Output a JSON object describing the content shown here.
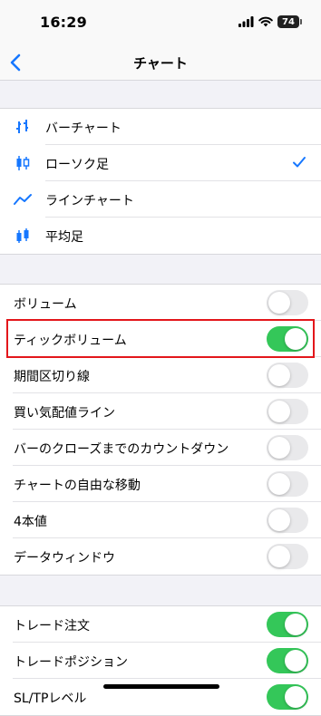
{
  "status_bar": {
    "time": "16:29",
    "battery": "74"
  },
  "nav": {
    "title": "チャート",
    "back_icon": "chevron-left-icon"
  },
  "chart_types": [
    {
      "label": "バーチャート",
      "icon": "bar-chart-icon",
      "selected": false
    },
    {
      "label": "ローソク足",
      "icon": "candlestick-icon",
      "selected": true
    },
    {
      "label": "ラインチャート",
      "icon": "line-chart-icon",
      "selected": false
    },
    {
      "label": "平均足",
      "icon": "heikin-ashi-icon",
      "selected": false
    }
  ],
  "display_settings": [
    {
      "label": "ボリューム",
      "on": false
    },
    {
      "label": "ティックボリューム",
      "on": true,
      "highlighted": true
    },
    {
      "label": "期間区切り線",
      "on": false
    },
    {
      "label": "買い気配値ライン",
      "on": false
    },
    {
      "label": "バーのクローズまでのカウントダウン",
      "on": false
    },
    {
      "label": "チャートの自由な移動",
      "on": false
    },
    {
      "label": "4本値",
      "on": false
    },
    {
      "label": "データウィンドウ",
      "on": false
    }
  ],
  "trade_settings": [
    {
      "label": "トレード注文",
      "on": true
    },
    {
      "label": "トレードポジション",
      "on": true
    },
    {
      "label": "SL/TPレベル",
      "on": true
    }
  ],
  "colors": {
    "accent": "#1677ff",
    "toggle_on": "#34c759",
    "highlight": "#e3161b"
  }
}
